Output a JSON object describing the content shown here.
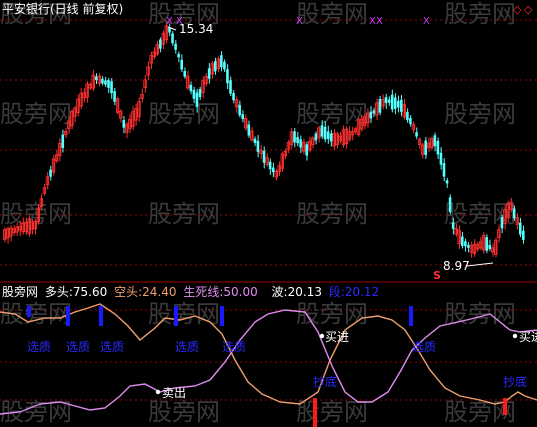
{
  "price_panel": {
    "title": "平安银行(日线 前复权)",
    "high_label": "15.34",
    "low_label": "8.97",
    "signal_marker": "S",
    "top_marker": "X",
    "corner_icons": [
      "diamond-outline-icon",
      "diamond-outline-icon"
    ]
  },
  "indicator_panel": {
    "name": "股旁网",
    "fields": [
      {
        "label": "多头:",
        "value": "75.60"
      },
      {
        "label": "空头:",
        "value": "24.40"
      },
      {
        "label": "生死线:",
        "value": "50.00"
      },
      {
        "label": "波:",
        "value": "20.13"
      },
      {
        "label": "段:",
        "value": "20.12"
      }
    ],
    "buy_marker_label": "选质",
    "buy_label": "买进",
    "sell_label": "卖出",
    "bottom_label": "抄底"
  },
  "watermark": "股旁网",
  "colors": {
    "background": "#000000",
    "up_candle": "#ff3030",
    "down_candle": "#54ffff",
    "bull_line": "#f0a070",
    "bear_line": "#e08cf0",
    "grid_dash": "#a00000",
    "panel_divider": "#a00000",
    "blue_bar": "#1a1aff",
    "red_bar": "#ff1a1a"
  }
}
